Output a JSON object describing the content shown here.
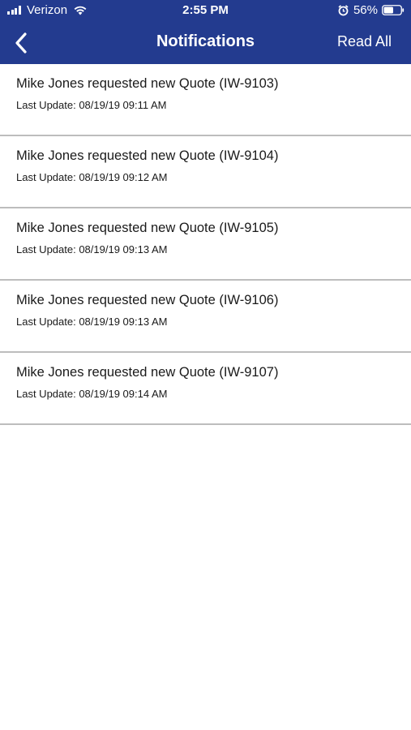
{
  "status_bar": {
    "carrier": "Verizon",
    "time": "2:55 PM",
    "battery": "56%",
    "icons": [
      "signal-icon",
      "wifi-icon",
      "alarm-icon",
      "battery-icon"
    ]
  },
  "nav": {
    "title": "Notifications",
    "read_all": "Read All",
    "back_icon": "chevron-left-icon"
  },
  "colors": {
    "header_bg": "#233b8f",
    "header_text": "#ffffff",
    "divider": "#bdbdbd",
    "background": "#ffffff"
  },
  "notifications": [
    {
      "title": "Mike Jones requested new Quote (IW-9103)",
      "meta": "Last Update: 08/19/19 09:11 AM"
    },
    {
      "title": "Mike Jones requested new Quote (IW-9104)",
      "meta": "Last Update: 08/19/19 09:12 AM"
    },
    {
      "title": "Mike Jones requested new Quote (IW-9105)",
      "meta": "Last Update: 08/19/19 09:13 AM"
    },
    {
      "title": "Mike Jones requested new Quote (IW-9106)",
      "meta": "Last Update: 08/19/19 09:13 AM"
    },
    {
      "title": "Mike Jones requested new Quote (IW-9107)",
      "meta": "Last Update: 08/19/19 09:14 AM"
    }
  ]
}
